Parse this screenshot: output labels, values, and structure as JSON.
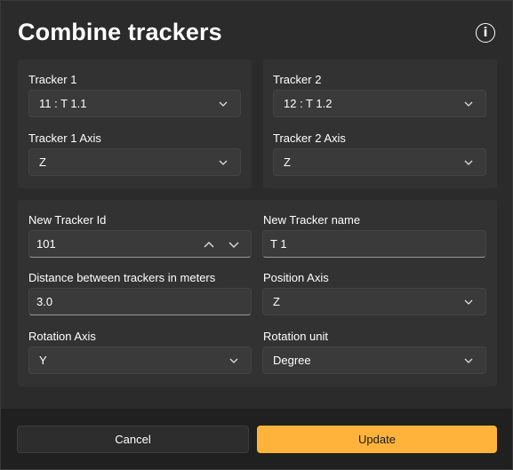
{
  "dialog": {
    "title": "Combine trackers",
    "info_icon": "info-circle-icon"
  },
  "tracker1": {
    "label": "Tracker 1",
    "value": "11 : T 1.1",
    "axis_label": "Tracker 1 Axis",
    "axis_value": "Z"
  },
  "tracker2": {
    "label": "Tracker 2",
    "value": "12 : T 1.2",
    "axis_label": "Tracker 2 Axis",
    "axis_value": "Z"
  },
  "new_tracker": {
    "id_label": "New Tracker Id",
    "id_value": "101",
    "name_label": "New Tracker name",
    "name_value": "T 1",
    "distance_label": "Distance between trackers in meters",
    "distance_value": "3.0",
    "position_axis_label": "Position Axis",
    "position_axis_value": "Z",
    "rotation_axis_label": "Rotation Axis",
    "rotation_axis_value": "Y",
    "rotation_unit_label": "Rotation unit",
    "rotation_unit_value": "Degree"
  },
  "footer": {
    "cancel_label": "Cancel",
    "update_label": "Update"
  },
  "colors": {
    "accent": "#ffb33a",
    "background": "#2b2b2b",
    "card": "#323232",
    "field": "#3a3a3a",
    "footer": "#202020"
  }
}
